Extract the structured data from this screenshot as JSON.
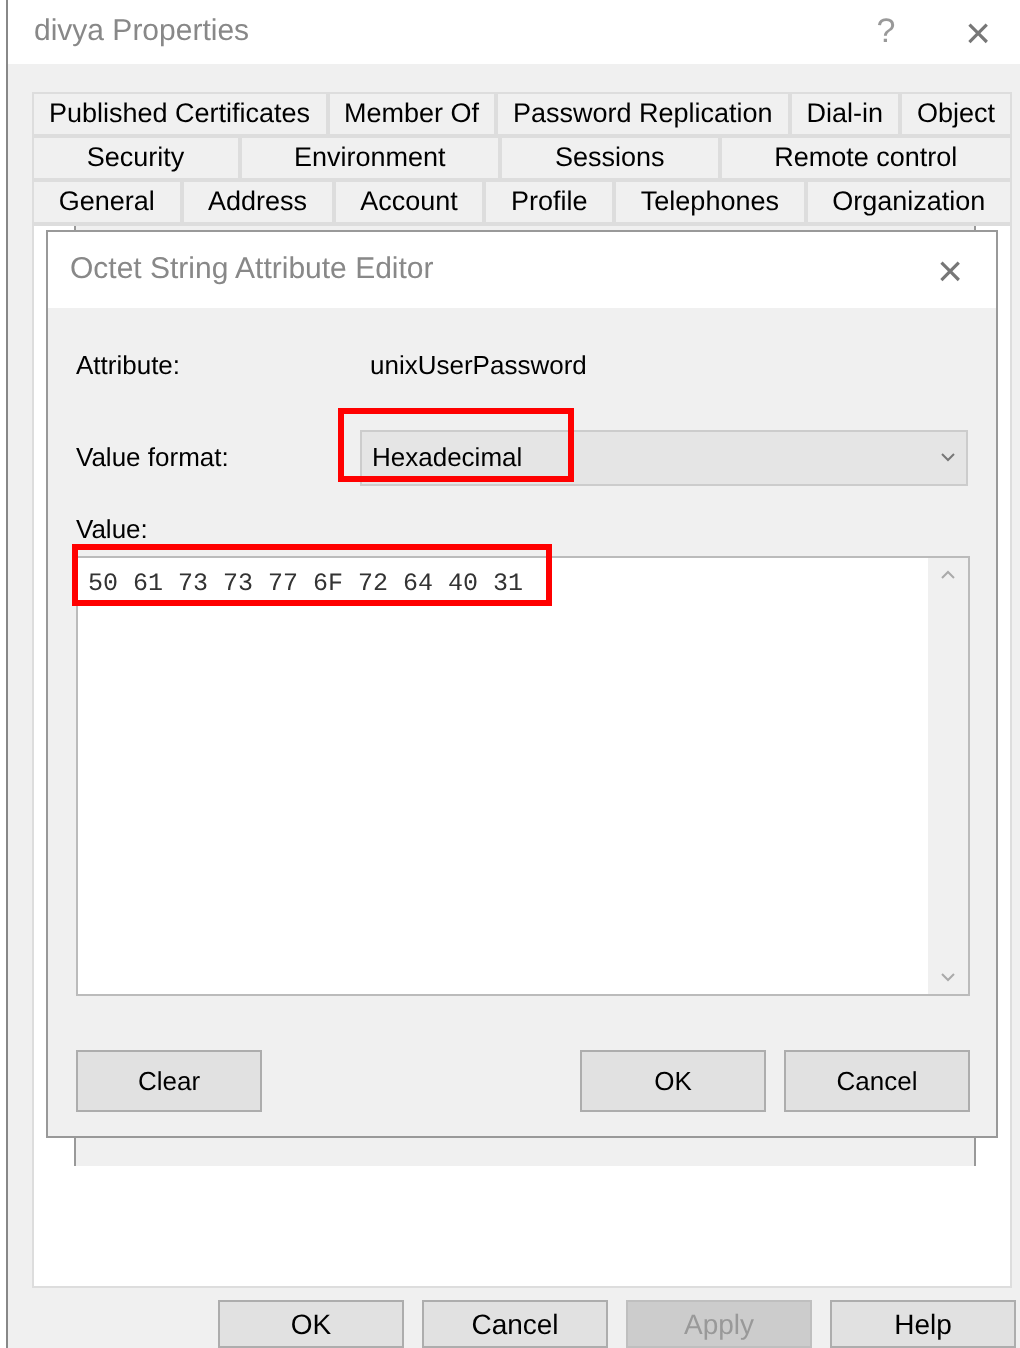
{
  "window": {
    "title": "divya Properties",
    "help": "?",
    "close": "×"
  },
  "tab_rows": [
    [
      {
        "label": "Published Certificates",
        "selected": false
      },
      {
        "label": "Member Of",
        "selected": false
      },
      {
        "label": "Password Replication",
        "selected": false
      },
      {
        "label": "Dial-in",
        "selected": false
      },
      {
        "label": "Object",
        "selected": false
      }
    ],
    [
      {
        "label": "Security",
        "selected": false
      },
      {
        "label": "Environment",
        "selected": false
      },
      {
        "label": "Sessions",
        "selected": false
      },
      {
        "label": "Remote control",
        "selected": false
      }
    ],
    [
      {
        "label": "General",
        "selected": false
      },
      {
        "label": "Address",
        "selected": false
      },
      {
        "label": "Account",
        "selected": false
      },
      {
        "label": "Profile",
        "selected": false
      },
      {
        "label": "Telephones",
        "selected": false
      },
      {
        "label": "Organization",
        "selected": false
      }
    ]
  ],
  "dialog": {
    "title": "Octet String Attribute Editor",
    "close": "×",
    "attribute_label": "Attribute:",
    "attribute_value": "unixUserPassword",
    "format_label": "Value format:",
    "format_value": "Hexadecimal",
    "format_highlighted": true,
    "value_label": "Value:",
    "value": "50 61 73 73 77 6F 72 64 40 31",
    "value_highlighted": true,
    "buttons": [
      {
        "label": "Clear",
        "kind": "left"
      },
      {
        "label": "OK",
        "kind": "right"
      },
      {
        "label": "Cancel",
        "kind": "right"
      }
    ]
  },
  "buttons": [
    {
      "label": "OK",
      "disabled": false
    },
    {
      "label": "Cancel",
      "disabled": false
    },
    {
      "label": "Apply",
      "disabled": true
    },
    {
      "label": "Help",
      "disabled": false
    }
  ]
}
